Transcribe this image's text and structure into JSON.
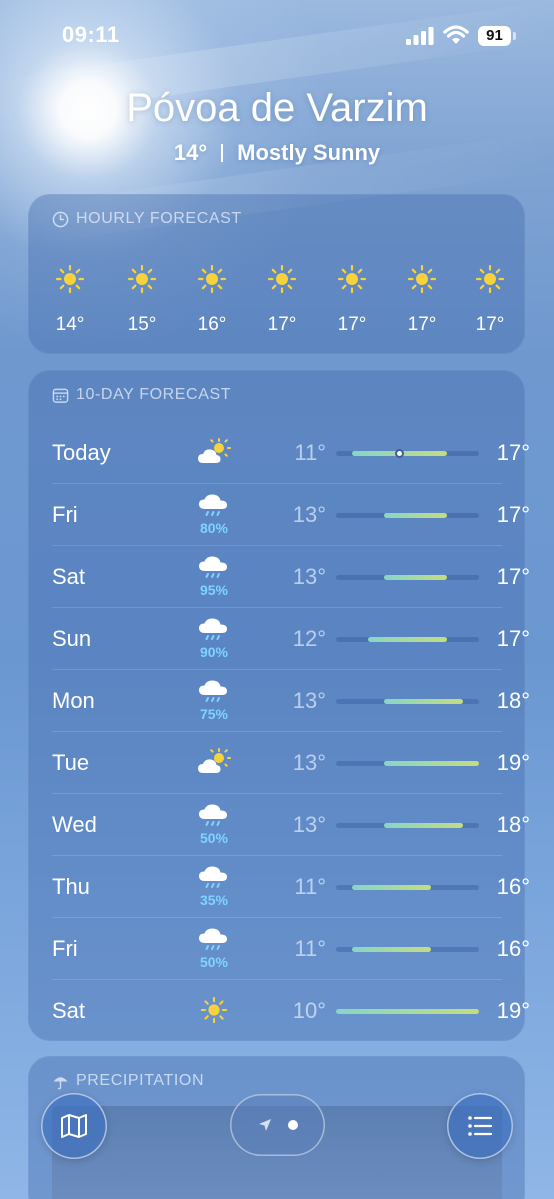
{
  "status_bar": {
    "time": "09:11",
    "battery": "91"
  },
  "header": {
    "city": "Póvoa de Varzim",
    "temperature": "14°",
    "condition": "Mostly Sunny"
  },
  "hourly": {
    "title": "HOURLY FORECAST",
    "items": [
      {
        "icon": "sun-icon",
        "temp": "14°"
      },
      {
        "icon": "sun-icon",
        "temp": "15°"
      },
      {
        "icon": "sun-icon",
        "temp": "16°"
      },
      {
        "icon": "sun-icon",
        "temp": "17°"
      },
      {
        "icon": "sun-icon",
        "temp": "17°"
      },
      {
        "icon": "sun-icon",
        "temp": "17°"
      },
      {
        "icon": "sun-icon",
        "temp": "17°"
      }
    ]
  },
  "ten_day": {
    "title": "10-DAY FORECAST",
    "range_min": 10,
    "range_max": 19,
    "current_temp": 14,
    "days": [
      {
        "day": "Today",
        "icon": "partly-sunny-icon",
        "precip": "",
        "low": "11°",
        "high": "17°",
        "low_val": 11,
        "high_val": 17
      },
      {
        "day": "Fri",
        "icon": "rain-icon",
        "precip": "80%",
        "low": "13°",
        "high": "17°",
        "low_val": 13,
        "high_val": 17
      },
      {
        "day": "Sat",
        "icon": "rain-icon",
        "precip": "95%",
        "low": "13°",
        "high": "17°",
        "low_val": 13,
        "high_val": 17
      },
      {
        "day": "Sun",
        "icon": "rain-icon",
        "precip": "90%",
        "low": "12°",
        "high": "17°",
        "low_val": 12,
        "high_val": 17
      },
      {
        "day": "Mon",
        "icon": "rain-icon",
        "precip": "75%",
        "low": "13°",
        "high": "18°",
        "low_val": 13,
        "high_val": 18
      },
      {
        "day": "Tue",
        "icon": "partly-sunny-icon",
        "precip": "",
        "low": "13°",
        "high": "19°",
        "low_val": 13,
        "high_val": 19
      },
      {
        "day": "Wed",
        "icon": "rain-icon",
        "precip": "50%",
        "low": "13°",
        "high": "18°",
        "low_val": 13,
        "high_val": 18
      },
      {
        "day": "Thu",
        "icon": "rain-icon",
        "precip": "35%",
        "low": "11°",
        "high": "16°",
        "low_val": 11,
        "high_val": 16
      },
      {
        "day": "Fri",
        "icon": "rain-icon",
        "precip": "50%",
        "low": "11°",
        "high": "16°",
        "low_val": 11,
        "high_val": 16
      },
      {
        "day": "Sat",
        "icon": "sun-icon",
        "precip": "",
        "low": "10°",
        "high": "19°",
        "low_val": 10,
        "high_val": 19
      }
    ]
  },
  "precipitation": {
    "title": "PRECIPITATION"
  },
  "toolbar": {
    "map_icon": "map-icon",
    "location_icon": "location-arrow-icon",
    "list_icon": "list-icon"
  }
}
